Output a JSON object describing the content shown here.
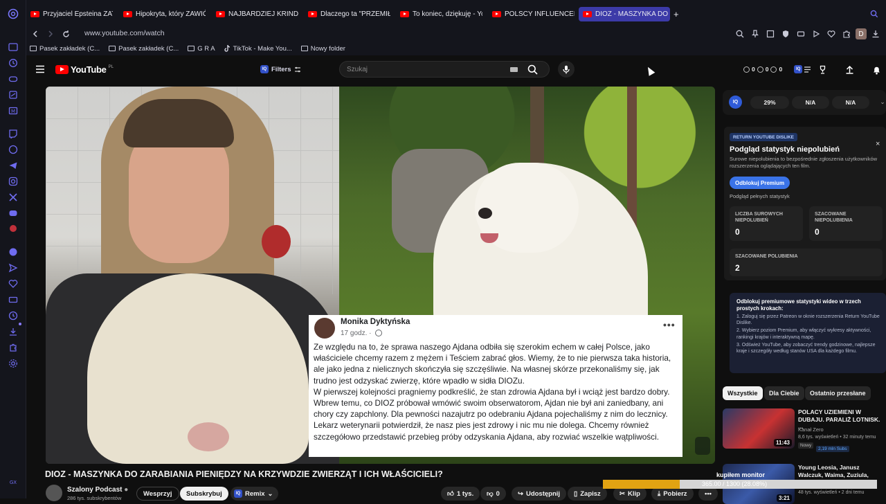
{
  "browser": {
    "tabs": [
      {
        "label": "Przyjaciel Epsteina ZATRZ",
        "active": false
      },
      {
        "label": "Hipokryta, który ZAWIÓDŁ",
        "active": false
      },
      {
        "label": "NAJBARDZIEJ KRINDŻOW",
        "active": false
      },
      {
        "label": "Dlaczego ta \"PRZEMIŁA\"",
        "active": false
      },
      {
        "label": "To koniec, dziękuję - YouT",
        "active": false
      },
      {
        "label": "POLSCY INFLUENCERZY",
        "active": false
      },
      {
        "label": "DIOZ - MASZYNKA DO",
        "active": true
      }
    ],
    "new_tab": "+",
    "url": "www.youtube.com/watch",
    "profile_letter": "D",
    "bookmarks": [
      {
        "label": "Pasek zakładek (C...",
        "icon": "folder-icon"
      },
      {
        "label": "Pasek zakładek (C...",
        "icon": "folder-icon"
      },
      {
        "label": "G R A",
        "icon": "folder-icon"
      },
      {
        "label": "TikTok - Make You...",
        "icon": "tiktok-icon"
      },
      {
        "label": "Nowy folder",
        "icon": "folder-icon"
      }
    ]
  },
  "youtube": {
    "logo_text": "YouTube",
    "region": "PL",
    "filters_label": "Filters",
    "iq_label": "IQ",
    "search_placeholder": "Szukaj",
    "counters": [
      "0",
      "0",
      "0"
    ]
  },
  "video": {
    "title": "DIOZ - MASZYNKA DO ZARABIANIA PIENIĘDZY NA KRZYWDZIE ZWIERZĄT I ICH WŁAŚCICIELI?",
    "fb_post": {
      "author": "Monika Dyktyńska",
      "time": "17 godz. ·",
      "more": "•••",
      "text": "Ze względu na to, że sprawa naszego Ajdana odbiła się szerokim echem w całej Polsce, jako właściciele chcemy razem z mężem i Teściem zabrać głos. Wiemy, że to nie pierwsza taka historia, ale jako jedna z nielicznych skończyła się szczęśliwie. Na własnej skórze przekonaliśmy się, jak trudno jest odzyskać zwierzę, które wpadło w sidła DIOZu.\nW pierwszej kolejności pragniemy podkreślić, że stan zdrowia Ajdana był i wciąż jest bardzo dobry. Wbrew temu, co DIOZ próbował wmówić swoim obserwatorom, Ajdan nie był ani zaniedbany, ani chory czy zapchlony. Dla pewności nazajutrz po odebraniu Ajdana pojechaliśmy z nim do lecznicy. Lekarz weterynarii potwierdził, że nasz pies jest zdrowy i nic mu nie dolega. Chcemy również szczegółowo przedstawić przebieg próby odzyskania Ajdana, aby rozwiać wszelkie wątpliwości."
    },
    "channel": {
      "name": "Szalony Podcast",
      "subs": "286 tys. subskrybentów"
    },
    "actions": {
      "join": "Wesprzyj",
      "subscribe": "Subskrybuj",
      "remix": "Remix",
      "likes": "1 tys.",
      "dislikes": "0",
      "share": "Udostępnij",
      "save": "Zapisz",
      "clip": "Klip",
      "download": "Pobierz",
      "more": "•••"
    }
  },
  "iq_bar": {
    "logo": "IQ",
    "pills": [
      "29%",
      "N/A",
      "N/A"
    ]
  },
  "rdd": {
    "badge": "RETURN YOUTUBE DISLIKE",
    "close": "×",
    "title": "Podgląd statystyk niepolubień",
    "description": "Surowe niepolubienia to bezpośrednie zgłoszenia użytkowników rozszerzenia oglądających ten film.",
    "button": "Odblokuj Premium",
    "link": "Podgląd pełnych statystyk",
    "stats": [
      {
        "label": "LICZBA SUROWYCH NIEPOLUBIEŃ",
        "value": "0"
      },
      {
        "label": "SZACOWANE NIEPOLUBIENIA",
        "value": "0"
      },
      {
        "label": "SZACOWANE POLUBIENIA",
        "value": "2"
      }
    ]
  },
  "premium": {
    "title": "Odblokuj premiumowe statystyki wideo w trzech prostych krokach:",
    "steps": [
      "1. Zaloguj się przez Patreon w oknie rozszerzenia Return YouTube Dislike.",
      "2. Wybierz poziom Premium, aby włączyć wykresy aktywności, rankingi krajów i interaktywną mapę.",
      "3. Odśwież YouTube, aby zobaczyć trendy godzinowe, najlepsze kraje i szczegóły według stanów USA dla każdego filmu."
    ]
  },
  "chips": [
    {
      "label": "Wszystkie",
      "active": true
    },
    {
      "label": "Dla Ciebie",
      "active": false
    },
    {
      "label": "Ostatnio przesłane",
      "active": false
    }
  ],
  "recommendations": [
    {
      "title": "POLACY UZIEMIENI W DUBAJU. PARALIŻ LOTNISK. ...",
      "channel": "Kanał Zero",
      "meta": "8,6 tys. wyświetleń • 32 minuty temu",
      "duration": "11:43",
      "badge": "Nowy",
      "badge2": "2,19 mln Subs"
    },
    {
      "title": "Young Leosia, Janusz Walczuk, Waima, Zuziula, Olinda - ...",
      "channel": "",
      "meta": "48 tys. wyświetleń • 2 dni temu",
      "duration": "3:21",
      "badge": "",
      "badge2": ""
    }
  ],
  "download": {
    "title": "kupiłem monitor",
    "progress_text": "365.00 / 1300 (28.08%)",
    "progress": 0.2808
  },
  "colors": {
    "accent": "#3c3aa8",
    "youtube_red": "#ff0000",
    "iq_blue": "#2f5bd8",
    "progress": "#e2a312"
  }
}
